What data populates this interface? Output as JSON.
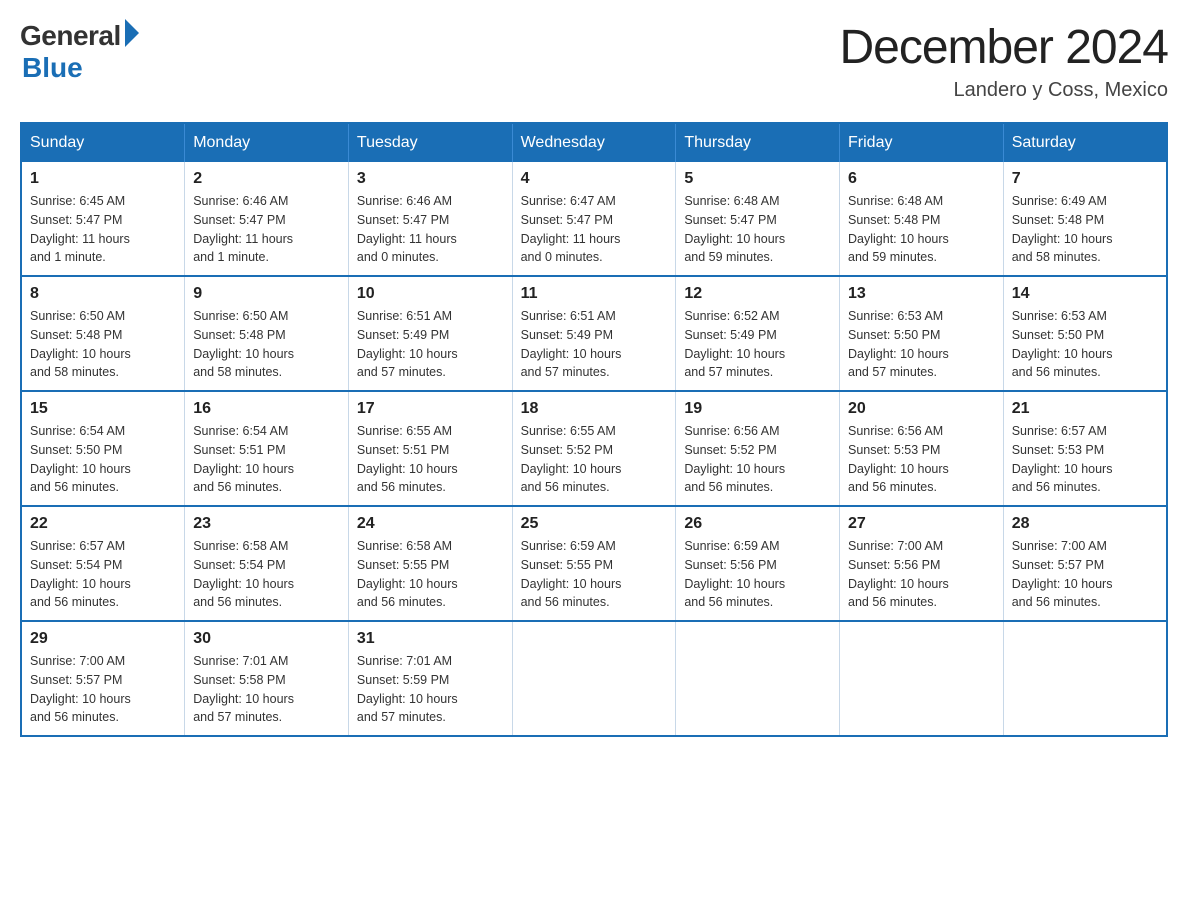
{
  "header": {
    "logo_general": "General",
    "logo_blue": "Blue",
    "month_title": "December 2024",
    "location": "Landero y Coss, Mexico"
  },
  "calendar": {
    "days_of_week": [
      "Sunday",
      "Monday",
      "Tuesday",
      "Wednesday",
      "Thursday",
      "Friday",
      "Saturday"
    ],
    "weeks": [
      [
        {
          "day": "1",
          "info": "Sunrise: 6:45 AM\nSunset: 5:47 PM\nDaylight: 11 hours\nand 1 minute."
        },
        {
          "day": "2",
          "info": "Sunrise: 6:46 AM\nSunset: 5:47 PM\nDaylight: 11 hours\nand 1 minute."
        },
        {
          "day": "3",
          "info": "Sunrise: 6:46 AM\nSunset: 5:47 PM\nDaylight: 11 hours\nand 0 minutes."
        },
        {
          "day": "4",
          "info": "Sunrise: 6:47 AM\nSunset: 5:47 PM\nDaylight: 11 hours\nand 0 minutes."
        },
        {
          "day": "5",
          "info": "Sunrise: 6:48 AM\nSunset: 5:47 PM\nDaylight: 10 hours\nand 59 minutes."
        },
        {
          "day": "6",
          "info": "Sunrise: 6:48 AM\nSunset: 5:48 PM\nDaylight: 10 hours\nand 59 minutes."
        },
        {
          "day": "7",
          "info": "Sunrise: 6:49 AM\nSunset: 5:48 PM\nDaylight: 10 hours\nand 58 minutes."
        }
      ],
      [
        {
          "day": "8",
          "info": "Sunrise: 6:50 AM\nSunset: 5:48 PM\nDaylight: 10 hours\nand 58 minutes."
        },
        {
          "day": "9",
          "info": "Sunrise: 6:50 AM\nSunset: 5:48 PM\nDaylight: 10 hours\nand 58 minutes."
        },
        {
          "day": "10",
          "info": "Sunrise: 6:51 AM\nSunset: 5:49 PM\nDaylight: 10 hours\nand 57 minutes."
        },
        {
          "day": "11",
          "info": "Sunrise: 6:51 AM\nSunset: 5:49 PM\nDaylight: 10 hours\nand 57 minutes."
        },
        {
          "day": "12",
          "info": "Sunrise: 6:52 AM\nSunset: 5:49 PM\nDaylight: 10 hours\nand 57 minutes."
        },
        {
          "day": "13",
          "info": "Sunrise: 6:53 AM\nSunset: 5:50 PM\nDaylight: 10 hours\nand 57 minutes."
        },
        {
          "day": "14",
          "info": "Sunrise: 6:53 AM\nSunset: 5:50 PM\nDaylight: 10 hours\nand 56 minutes."
        }
      ],
      [
        {
          "day": "15",
          "info": "Sunrise: 6:54 AM\nSunset: 5:50 PM\nDaylight: 10 hours\nand 56 minutes."
        },
        {
          "day": "16",
          "info": "Sunrise: 6:54 AM\nSunset: 5:51 PM\nDaylight: 10 hours\nand 56 minutes."
        },
        {
          "day": "17",
          "info": "Sunrise: 6:55 AM\nSunset: 5:51 PM\nDaylight: 10 hours\nand 56 minutes."
        },
        {
          "day": "18",
          "info": "Sunrise: 6:55 AM\nSunset: 5:52 PM\nDaylight: 10 hours\nand 56 minutes."
        },
        {
          "day": "19",
          "info": "Sunrise: 6:56 AM\nSunset: 5:52 PM\nDaylight: 10 hours\nand 56 minutes."
        },
        {
          "day": "20",
          "info": "Sunrise: 6:56 AM\nSunset: 5:53 PM\nDaylight: 10 hours\nand 56 minutes."
        },
        {
          "day": "21",
          "info": "Sunrise: 6:57 AM\nSunset: 5:53 PM\nDaylight: 10 hours\nand 56 minutes."
        }
      ],
      [
        {
          "day": "22",
          "info": "Sunrise: 6:57 AM\nSunset: 5:54 PM\nDaylight: 10 hours\nand 56 minutes."
        },
        {
          "day": "23",
          "info": "Sunrise: 6:58 AM\nSunset: 5:54 PM\nDaylight: 10 hours\nand 56 minutes."
        },
        {
          "day": "24",
          "info": "Sunrise: 6:58 AM\nSunset: 5:55 PM\nDaylight: 10 hours\nand 56 minutes."
        },
        {
          "day": "25",
          "info": "Sunrise: 6:59 AM\nSunset: 5:55 PM\nDaylight: 10 hours\nand 56 minutes."
        },
        {
          "day": "26",
          "info": "Sunrise: 6:59 AM\nSunset: 5:56 PM\nDaylight: 10 hours\nand 56 minutes."
        },
        {
          "day": "27",
          "info": "Sunrise: 7:00 AM\nSunset: 5:56 PM\nDaylight: 10 hours\nand 56 minutes."
        },
        {
          "day": "28",
          "info": "Sunrise: 7:00 AM\nSunset: 5:57 PM\nDaylight: 10 hours\nand 56 minutes."
        }
      ],
      [
        {
          "day": "29",
          "info": "Sunrise: 7:00 AM\nSunset: 5:57 PM\nDaylight: 10 hours\nand 56 minutes."
        },
        {
          "day": "30",
          "info": "Sunrise: 7:01 AM\nSunset: 5:58 PM\nDaylight: 10 hours\nand 57 minutes."
        },
        {
          "day": "31",
          "info": "Sunrise: 7:01 AM\nSunset: 5:59 PM\nDaylight: 10 hours\nand 57 minutes."
        },
        null,
        null,
        null,
        null
      ]
    ]
  }
}
